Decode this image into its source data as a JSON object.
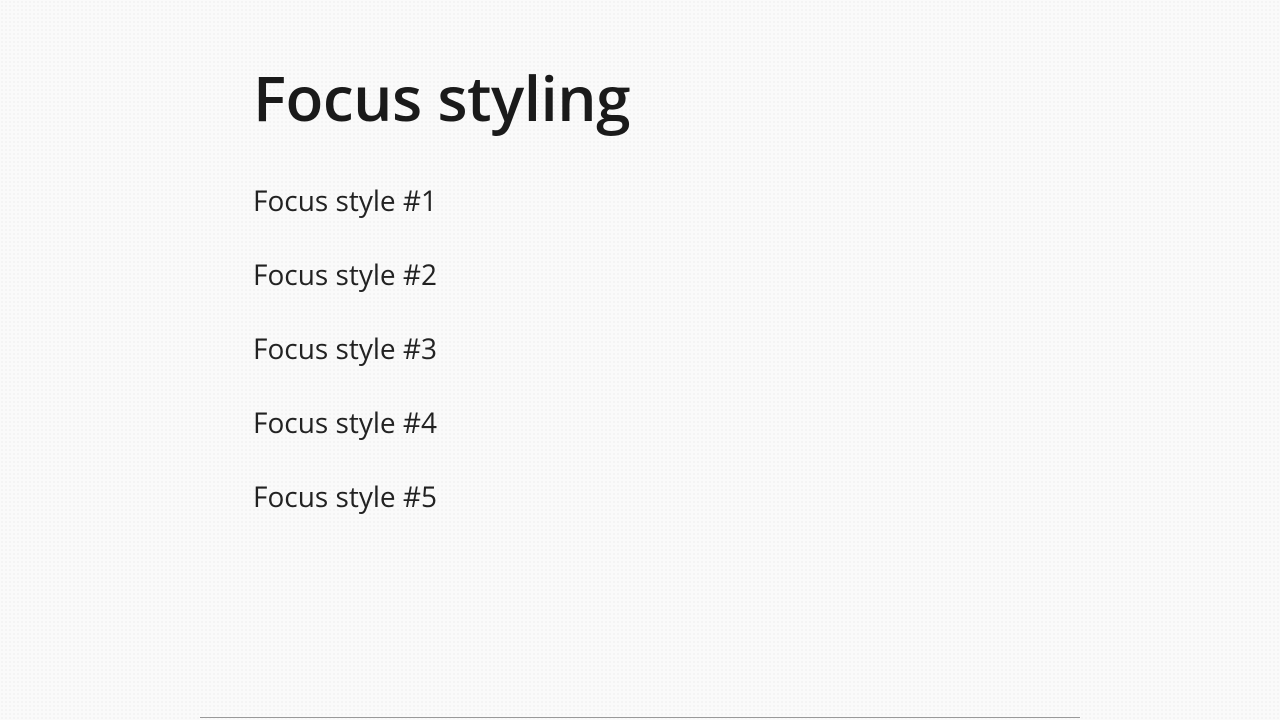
{
  "heading": "Focus styling",
  "links": [
    "Focus style #1",
    "Focus style #2",
    "Focus style #3",
    "Focus style #4",
    "Focus style #5"
  ]
}
